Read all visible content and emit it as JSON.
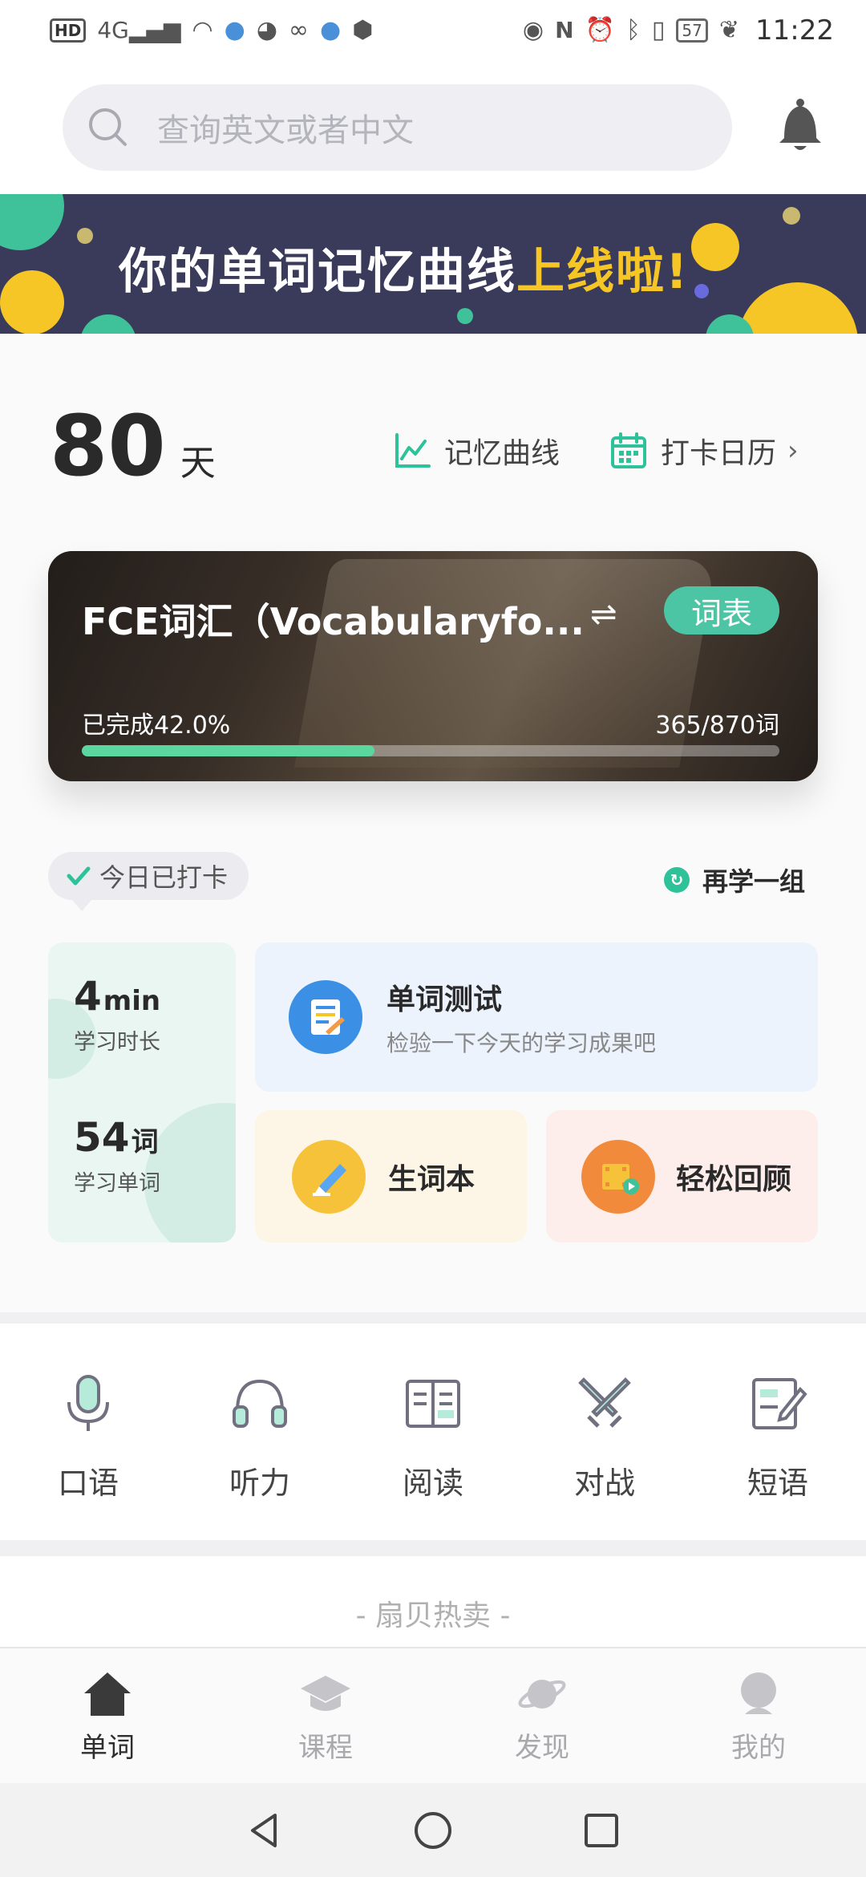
{
  "status_bar": {
    "hd": "HD",
    "network": "4G",
    "battery": "57",
    "time": "11:22"
  },
  "search": {
    "placeholder": "查询英文或者中文"
  },
  "banner": {
    "title_white": "你的单词记忆曲线",
    "title_yellow": "上线啦!"
  },
  "streak": {
    "days": "80",
    "unit": "天"
  },
  "links": {
    "memory_curve": "记忆曲线",
    "calendar": "打卡日历"
  },
  "book": {
    "title": "FCE词汇（Vocabularyfo...",
    "wordlist_button": "词表",
    "progress_label": "已完成42.0%",
    "progress_fraction": 0.42,
    "count": "365/870词"
  },
  "checkin": {
    "label": "今日已打卡",
    "relearn": "再学一组"
  },
  "stats": {
    "time_value": "4",
    "time_unit": "min",
    "time_label": "学习时长",
    "words_value": "54",
    "words_unit": "词",
    "words_label": "学习单词"
  },
  "cards": {
    "test_title": "单词测试",
    "test_sub": "检验一下今天的学习成果吧",
    "notebook": "生词本",
    "review": "轻松回顾"
  },
  "quicknav": [
    "口语",
    "听力",
    "阅读",
    "对战",
    "短语"
  ],
  "hot_label": "- 扇贝热卖 -",
  "tabs": [
    "单词",
    "课程",
    "发现",
    "我的"
  ],
  "colors": {
    "accent": "#4cc5a4",
    "progress": "#5cd69f",
    "banner_bg": "#3a3a5a",
    "banner_highlight": "#f6c626"
  }
}
